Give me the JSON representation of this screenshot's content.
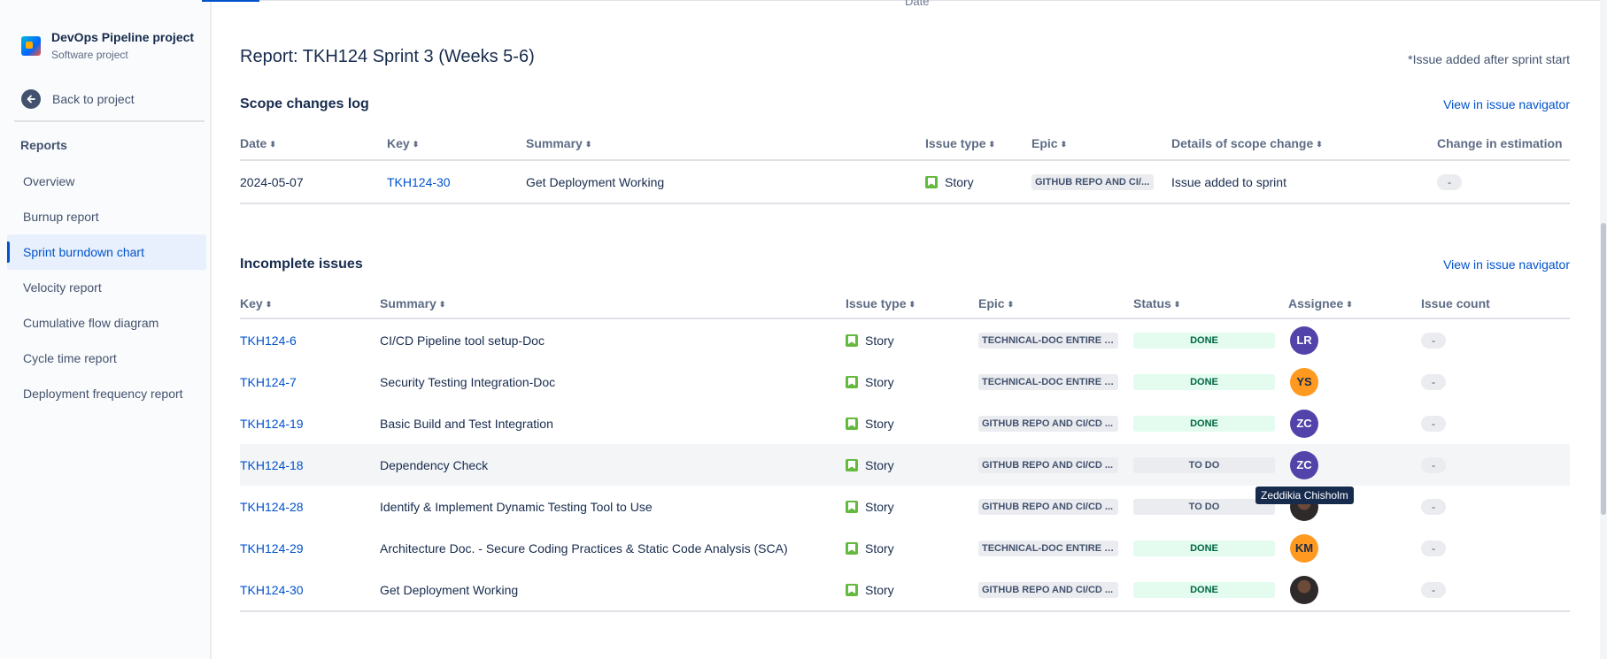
{
  "sidebar": {
    "project_name": "DevOps Pipeline project",
    "project_type": "Software project",
    "back_label": "Back to project",
    "reports_heading": "Reports",
    "items": [
      {
        "label": "Overview",
        "active": false
      },
      {
        "label": "Burnup report",
        "active": false
      },
      {
        "label": "Sprint burndown chart",
        "active": true
      },
      {
        "label": "Velocity report",
        "active": false
      },
      {
        "label": "Cumulative flow diagram",
        "active": false
      },
      {
        "label": "Cycle time report",
        "active": false
      },
      {
        "label": "Deployment frequency report",
        "active": false
      }
    ]
  },
  "top": {
    "date_label": "Date"
  },
  "report": {
    "title": "Report: TKH124 Sprint 3 (Weeks 5-6)",
    "note": "*Issue added after sprint start"
  },
  "scope": {
    "title": "Scope changes log",
    "link": "View in issue navigator",
    "headers": {
      "date": "Date",
      "key": "Key",
      "summary": "Summary",
      "issue_type": "Issue type",
      "epic": "Epic",
      "details": "Details of scope change",
      "change": "Change in estimation"
    },
    "rows": [
      {
        "date": "2024-05-07",
        "key": "TKH124-30",
        "summary": "Get Deployment Working",
        "issue_type": "Story",
        "epic": "GITHUB REPO AND CI/...",
        "details": "Issue added to sprint",
        "change": "-"
      }
    ]
  },
  "incomplete": {
    "title": "Incomplete issues",
    "link": "View in issue navigator",
    "headers": {
      "key": "Key",
      "summary": "Summary",
      "issue_type": "Issue type",
      "epic": "Epic",
      "status": "Status",
      "assignee": "Assignee",
      "count": "Issue count"
    },
    "rows": [
      {
        "key": "TKH124-6",
        "summary": "CI/CD Pipeline tool setup-Doc",
        "issue_type": "Story",
        "epic": "TECHNICAL-DOC ENTIRE P...",
        "status": "DONE",
        "status_kind": "done",
        "assignee": "LR",
        "avatar_kind": "purple",
        "count": "-"
      },
      {
        "key": "TKH124-7",
        "summary": "Security Testing Integration-Doc",
        "issue_type": "Story",
        "epic": "TECHNICAL-DOC ENTIRE P...",
        "status": "DONE",
        "status_kind": "done",
        "assignee": "YS",
        "avatar_kind": "orange",
        "count": "-"
      },
      {
        "key": "TKH124-19",
        "summary": "Basic Build and Test Integration",
        "issue_type": "Story",
        "epic": "GITHUB REPO AND CI/CD ...",
        "status": "DONE",
        "status_kind": "done",
        "assignee": "ZC",
        "avatar_kind": "purple",
        "count": "-"
      },
      {
        "key": "TKH124-18",
        "summary": "Dependency Check",
        "issue_type": "Story",
        "epic": "GITHUB REPO AND CI/CD ...",
        "status": "TO DO",
        "status_kind": "todo",
        "assignee": "ZC",
        "avatar_kind": "purple",
        "count": "-"
      },
      {
        "key": "TKH124-28",
        "summary": "Identify & Implement Dynamic Testing Tool to Use",
        "issue_type": "Story",
        "epic": "GITHUB REPO AND CI/CD ...",
        "status": "TO DO",
        "status_kind": "todo",
        "assignee": "",
        "avatar_kind": "photo",
        "count": "-"
      },
      {
        "key": "TKH124-29",
        "summary": "Architecture Doc. - Secure Coding Practices & Static Code Analysis (SCA)",
        "issue_type": "Story",
        "epic": "TECHNICAL-DOC ENTIRE P...",
        "status": "DONE",
        "status_kind": "done",
        "assignee": "KM",
        "avatar_kind": "orange",
        "count": "-"
      },
      {
        "key": "TKH124-30",
        "summary": "Get Deployment Working",
        "issue_type": "Story",
        "epic": "GITHUB REPO AND CI/CD ...",
        "status": "DONE",
        "status_kind": "done",
        "assignee": "",
        "avatar_kind": "photo",
        "count": "-"
      }
    ],
    "tooltip": "Zeddikia Chisholm"
  },
  "colors": {
    "accent": "#0052cc",
    "story": "#63ba3c",
    "done_bg": "#e3fcef",
    "done_text": "#006644",
    "avatar_purple": "#5243aa",
    "avatar_orange": "#ff991f"
  },
  "icons": {
    "back": "arrow-left-icon",
    "story": "bookmark-icon",
    "sort": "sort-arrows-icon"
  }
}
